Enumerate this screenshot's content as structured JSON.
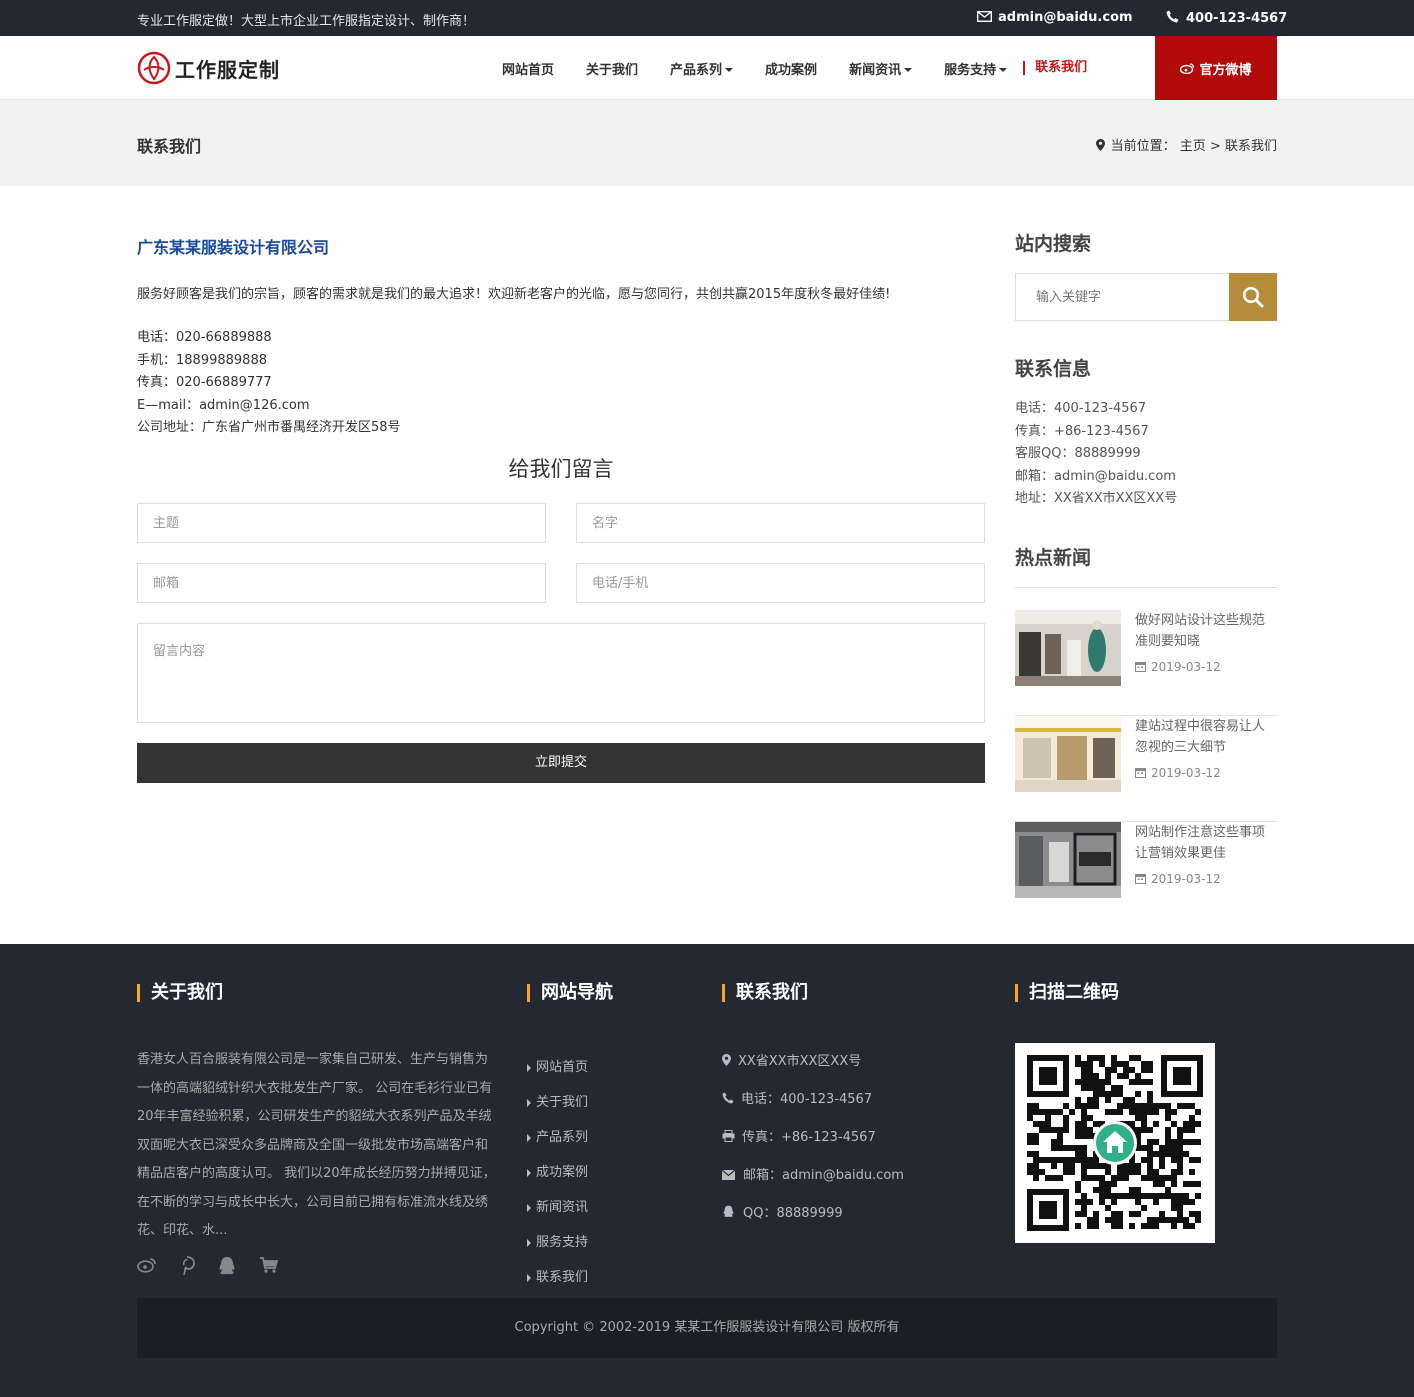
{
  "topbar": {
    "slogan": "专业工作服定做！大型上市企业工作服指定设计、制作商！",
    "email": "admin@baidu.com",
    "phone": "400-123-4567",
    "email_icon": "envelope-icon",
    "phone_icon": "phone-icon"
  },
  "header": {
    "logo_text": "工作服定制",
    "nav": [
      {
        "label": "网站首页"
      },
      {
        "label": "关于我们"
      },
      {
        "label": "产品系列"
      },
      {
        "label": "成功案例"
      },
      {
        "label": "新闻资讯"
      },
      {
        "label": "服务支持"
      },
      {
        "label": "联系我们"
      }
    ],
    "weibo_label": "官方微博"
  },
  "titlebar": {
    "title": "联系我们",
    "breadcrumb_prefix": "当前位置：",
    "breadcrumb_home": "主页",
    "breadcrumb_sep": ">",
    "breadcrumb_current": "联系我们"
  },
  "main": {
    "company": "广东某某服装设计有限公司",
    "intro": "服务好顾客是我们的宗旨，顾客的需求就是我们的最大追求！欢迎新老客户的光临，愿与您同行，共创共赢2015年度秋冬最好佳绩!",
    "contacts": [
      "电话：020-66889888",
      "手机：18899889888",
      "传真：020-66889777",
      "E—mail：admin@126.com",
      "公司地址：广东省广州市番禺经济开发区58号"
    ],
    "form": {
      "title": "给我们留言",
      "subject_placeholder": "主题",
      "name_placeholder": "名字",
      "email_placeholder": "邮箱",
      "phone_placeholder": "电话/手机",
      "message_placeholder": "留言内容",
      "submit_label": "立即提交"
    }
  },
  "sidebar": {
    "search_heading": "站内搜索",
    "search_placeholder": "输入关键字",
    "contact_heading": "联系信息",
    "contact_lines": [
      "电话：400-123-4567",
      "传真：+86-123-4567",
      "客服QQ：88889999",
      "邮箱：admin@baidu.com",
      "地址：XX省XX市XX区XX号"
    ],
    "news_heading": "热点新闻",
    "news": [
      {
        "title": "做好网站设计这些规范准则要知晓",
        "date": "2019-03-12"
      },
      {
        "title": "建站过程中很容易让人忽视的三大细节",
        "date": "2019-03-12"
      },
      {
        "title": "网站制作注意这些事项让营销效果更佳",
        "date": "2019-03-12"
      }
    ]
  },
  "footer": {
    "about_heading": "关于我们",
    "about_text": "香港女人百合服装有限公司是一家集自己研发、生产与销售为一体的高端貂绒针织大衣批发生产厂家。 公司在毛衫行业已有20年丰富经验积累，公司研发生产的貂绒大衣系列产品及羊绒双面呢大衣已深受众多品牌商及全国一级批发市场高端客户和精品店客户的高度认可。 我们以20年成长经历努力拼搏见证，在不断的学习与成长中长大，公司目前已拥有标准流水线及绣花、印花、水...",
    "nav_heading": "网站导航",
    "nav_links": [
      "网站首页",
      "关于我们",
      "产品系列",
      "成功案例",
      "新闻资讯",
      "服务支持",
      "联系我们"
    ],
    "contact_heading": "联系我们",
    "contact_lines": [
      "XX省XX市XX区XX号",
      "电话：400-123-4567",
      "传真：+86-123-4567",
      "邮箱：admin@baidu.com",
      "QQ：88889999"
    ],
    "qr_heading": "扫描二维码",
    "copyright": "Copyright © 2002-2019 某某工作服服装设计有限公司 版权所有"
  },
  "colors": {
    "topbar_bg": "#232831",
    "accent_red": "#b20a0a",
    "company_blue": "#1a4a9b",
    "search_btn": "#b48c3c",
    "footer_accent": "#f5a623"
  }
}
